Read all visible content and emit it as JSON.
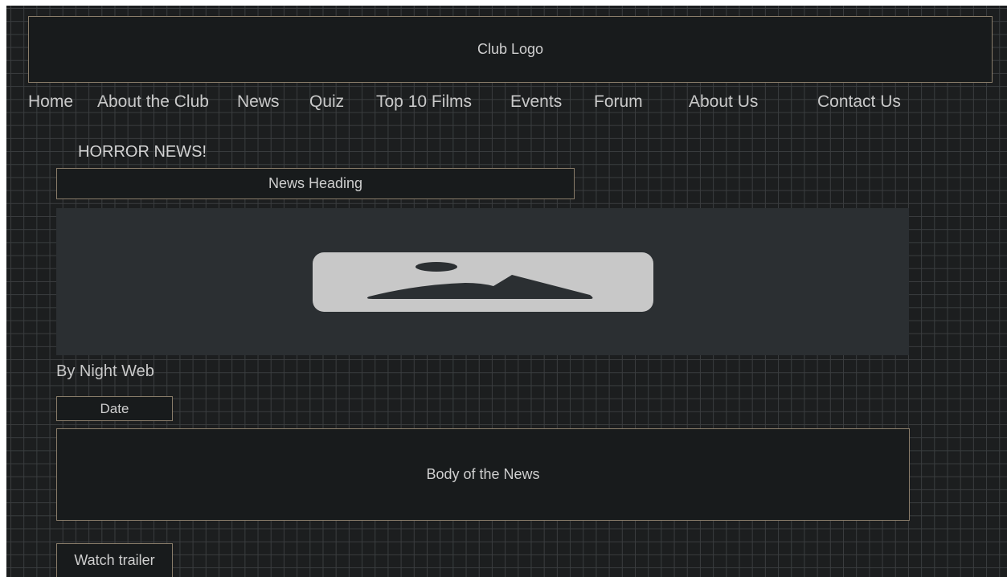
{
  "header": {
    "logo_label": "Club Logo"
  },
  "nav": {
    "items": [
      {
        "label": "Home"
      },
      {
        "label": "About the Club"
      },
      {
        "label": "News"
      },
      {
        "label": "Quiz"
      },
      {
        "label": "Top 10 Films"
      },
      {
        "label": "Events"
      },
      {
        "label": "Forum"
      },
      {
        "label": "About Us"
      },
      {
        "label": "Contact Us"
      }
    ]
  },
  "news": {
    "section_title": "HORROR NEWS!",
    "heading": "News Heading",
    "image_icon": "image-placeholder-icon",
    "author": "By Night Web",
    "date": "Date",
    "body": "Body of the News",
    "trailer_button": "Watch trailer"
  },
  "colors": {
    "background": "#1c1e1f",
    "box_fill": "#181b1c",
    "box_border": "#8a7d6a",
    "image_area": "#2b2f32",
    "text": "#c9c9c9"
  }
}
